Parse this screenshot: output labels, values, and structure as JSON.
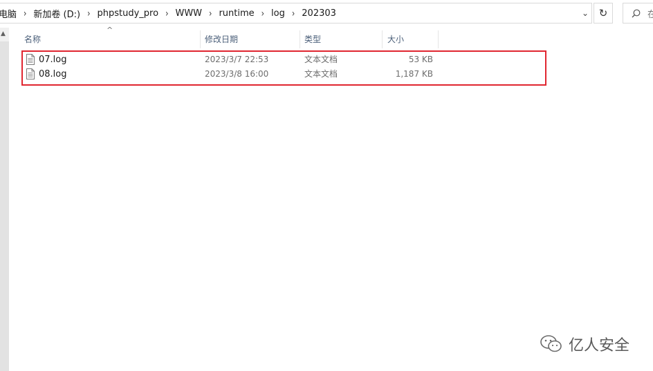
{
  "address_bar": {
    "breadcrumbs": [
      "电脑",
      "新加卷 (D:)",
      "phpstudy_pro",
      "WWW",
      "runtime",
      "log",
      "202303"
    ]
  },
  "search": {
    "placeholder": "在"
  },
  "columns": {
    "name": "名称",
    "date": "修改日期",
    "type": "类型",
    "size": "大小"
  },
  "files": [
    {
      "name": "07.log",
      "date": "2023/3/7 22:53",
      "type": "文本文档",
      "size": "53 KB"
    },
    {
      "name": "08.log",
      "date": "2023/3/8 16:00",
      "type": "文本文档",
      "size": "1,187 KB"
    }
  ],
  "watermark": {
    "text": "亿人安全"
  },
  "colors": {
    "highlight_border": "#e0252f",
    "header_text": "#4c607a"
  }
}
